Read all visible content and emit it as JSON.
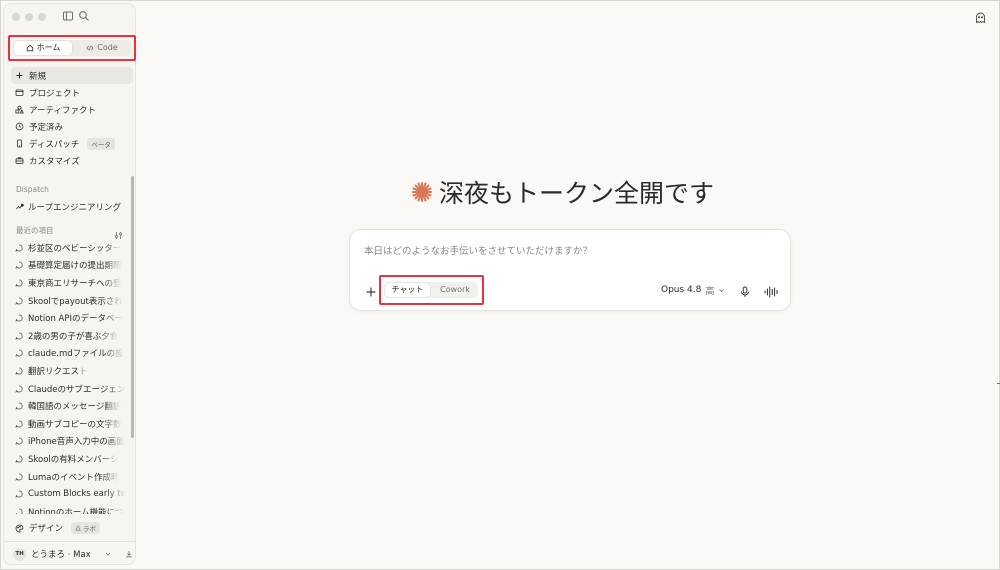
{
  "sidebar": {
    "mode_tabs": [
      {
        "label": "ホーム",
        "icon": "home-icon",
        "active": true
      },
      {
        "label": "Code",
        "icon": "code-icon",
        "active": false
      }
    ],
    "nav_items": [
      {
        "label": "新規",
        "icon": "plus-icon",
        "active": true
      },
      {
        "label": "プロジェクト",
        "icon": "folder-icon"
      },
      {
        "label": "アーティファクト",
        "icon": "shapes-icon"
      },
      {
        "label": "予定済み",
        "icon": "clock-icon"
      },
      {
        "label": "ディスパッチ",
        "icon": "phone-icon",
        "badge": "ベータ"
      },
      {
        "label": "カスタマイズ",
        "icon": "briefcase-icon"
      }
    ],
    "dispatch_section": {
      "label": "Dispatch",
      "item": "ループエンジニアリング"
    },
    "recents_section": {
      "label": "最近の項目",
      "items": [
        "杉並区のベビーシッター",
        "基礎算定届けの提出期限",
        "東京商エリサーチへの登",
        "Skoolでpayout表示され",
        "Notion APIのデータベー",
        "2歳の男の子が喜ぶ夕食",
        "claude.mdファイルの設",
        "翻訳リクエスト",
        "Claudeのサブエージェント",
        "韓国語のメッセージ翻訳",
        "動画サブコピーの文字数",
        "iPhone音声入力中の画面",
        "Skoolの有料メンバーシ",
        "Lumaのイベント作成時",
        "Custom Blocks early te",
        "Notionのホーム機能につ"
      ]
    },
    "bottom_item": {
      "label": "デザイン",
      "badge": "ラボ",
      "icon": "palette-icon"
    },
    "user": {
      "initials": "TH",
      "name": "とうまろ · Max"
    }
  },
  "main": {
    "greeting": "深夜もトークン全開です",
    "composer": {
      "placeholder": "本日はどのようなお手伝いをさせていただけますか？",
      "modes": [
        {
          "label": "チャット",
          "active": true
        },
        {
          "label": "Cowork",
          "active": false
        }
      ],
      "model": "Opus 4.8",
      "effort": "高"
    }
  },
  "colors": {
    "accent": "#d97757",
    "highlight_box": "#e3343f",
    "background": "#faf9f6"
  }
}
